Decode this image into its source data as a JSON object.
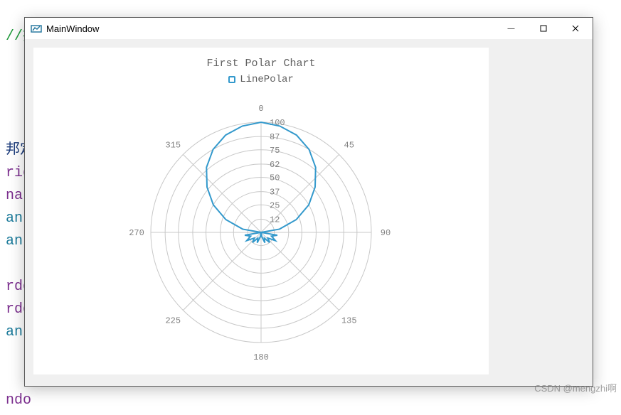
{
  "background_code": {
    "line1": "//把点存进去",
    "lines": [
      "邦定",
      "rid",
      "nar",
      "an",
      "an",
      "",
      "rdo",
      "rdo",
      "an",
      "",
      "ndo"
    ]
  },
  "window": {
    "title": "MainWindow",
    "buttons": {
      "minimize": "—",
      "maximize": "▢",
      "close": "✕"
    }
  },
  "chart": {
    "title": "First Polar Chart",
    "legend_label": "LinePolar",
    "angle_ticks": [
      "0",
      "45",
      "90",
      "135",
      "180",
      "225",
      "270",
      "315"
    ],
    "radius_ticks": [
      "12",
      "25",
      "37",
      "50",
      "62",
      "75",
      "87",
      "100"
    ]
  },
  "watermark": "CSDN @mengzhi啊",
  "chart_data": {
    "type": "polar-line",
    "title": "First Polar Chart",
    "series_name": "LinePolar",
    "angle_axis": {
      "min": 0,
      "max": 360,
      "ticks": [
        0,
        45,
        90,
        135,
        180,
        225,
        270,
        315
      ]
    },
    "radius_axis": {
      "min": 0,
      "max": 100,
      "ticks": [
        12,
        25,
        37,
        50,
        62,
        75,
        87,
        100
      ]
    },
    "series": [
      {
        "name": "LinePolar",
        "points": [
          {
            "angle": 0,
            "r": 100
          },
          {
            "angle": 10,
            "r": 98
          },
          {
            "angle": 20,
            "r": 94
          },
          {
            "angle": 30,
            "r": 87
          },
          {
            "angle": 40,
            "r": 77
          },
          {
            "angle": 50,
            "r": 64
          },
          {
            "angle": 60,
            "r": 50
          },
          {
            "angle": 70,
            "r": 34
          },
          {
            "angle": 80,
            "r": 17
          },
          {
            "angle": 90,
            "r": 0
          },
          {
            "angle": 100,
            "r": 15
          },
          {
            "angle": 110,
            "r": 10
          },
          {
            "angle": 120,
            "r": 15
          },
          {
            "angle": 130,
            "r": 8
          },
          {
            "angle": 140,
            "r": 12
          },
          {
            "angle": 150,
            "r": 6
          },
          {
            "angle": 160,
            "r": 10
          },
          {
            "angle": 170,
            "r": 4
          },
          {
            "angle": 180,
            "r": 0
          },
          {
            "angle": 190,
            "r": 4
          },
          {
            "angle": 200,
            "r": 10
          },
          {
            "angle": 210,
            "r": 6
          },
          {
            "angle": 220,
            "r": 12
          },
          {
            "angle": 230,
            "r": 8
          },
          {
            "angle": 240,
            "r": 15
          },
          {
            "angle": 250,
            "r": 10
          },
          {
            "angle": 260,
            "r": 15
          },
          {
            "angle": 270,
            "r": 0
          },
          {
            "angle": 280,
            "r": 17
          },
          {
            "angle": 290,
            "r": 34
          },
          {
            "angle": 300,
            "r": 50
          },
          {
            "angle": 310,
            "r": 64
          },
          {
            "angle": 320,
            "r": 77
          },
          {
            "angle": 330,
            "r": 87
          },
          {
            "angle": 340,
            "r": 94
          },
          {
            "angle": 350,
            "r": 98
          }
        ]
      }
    ]
  }
}
